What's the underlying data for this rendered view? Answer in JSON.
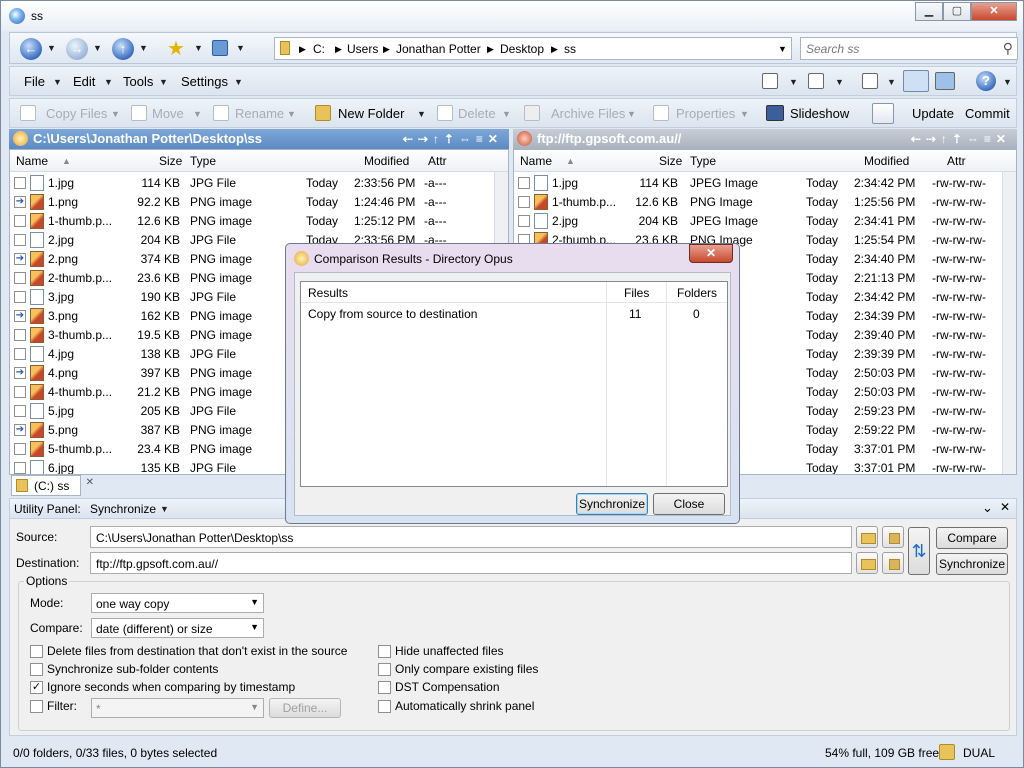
{
  "window": {
    "title": "ss"
  },
  "address": {
    "drive": "C:",
    "parts": [
      "Users",
      "Jonathan Potter",
      "Desktop",
      "ss"
    ]
  },
  "search": {
    "placeholder": "Search ss"
  },
  "menu": {
    "file": "File",
    "edit": "Edit",
    "tools": "Tools",
    "settings": "Settings"
  },
  "toolbar": {
    "copy_files": "Copy Files",
    "move": "Move",
    "rename": "Rename",
    "new_folder": "New Folder",
    "delete": "Delete",
    "archive_files": "Archive Files",
    "properties": "Properties",
    "slideshow": "Slideshow",
    "update": "Update",
    "commit": "Commit"
  },
  "left_pane": {
    "path": "C:\\Users\\Jonathan Potter\\Desktop\\ss",
    "headers": {
      "name": "Name",
      "size": "Size",
      "type": "Type",
      "modified": "Modified",
      "attr": "Attr"
    },
    "rows": [
      {
        "name": "1.jpg",
        "size": "114 KB",
        "type": "JPG File",
        "date": "Today",
        "time": "2:33:56 PM",
        "attr": "-a---",
        "kind": "jpg"
      },
      {
        "name": "1.png",
        "size": "92.2 KB",
        "type": "PNG image",
        "date": "Today",
        "time": "1:24:46 PM",
        "attr": "-a---",
        "kind": "pngarrow"
      },
      {
        "name": "1-thumb.p...",
        "size": "12.6 KB",
        "type": "PNG image",
        "date": "Today",
        "time": "1:25:12 PM",
        "attr": "-a---",
        "kind": "png"
      },
      {
        "name": "2.jpg",
        "size": "204 KB",
        "type": "JPG File",
        "date": "Today",
        "time": "2:33:56 PM",
        "attr": "-a---",
        "kind": "jpg"
      },
      {
        "name": "2.png",
        "size": "374 KB",
        "type": "PNG image",
        "date": "",
        "time": "",
        "attr": "",
        "kind": "pngarrow"
      },
      {
        "name": "2-thumb.p...",
        "size": "23.6 KB",
        "type": "PNG image",
        "date": "",
        "time": "",
        "attr": "",
        "kind": "png"
      },
      {
        "name": "3.jpg",
        "size": "190 KB",
        "type": "JPG File",
        "date": "",
        "time": "",
        "attr": "",
        "kind": "jpg"
      },
      {
        "name": "3.png",
        "size": "162 KB",
        "type": "PNG image",
        "date": "",
        "time": "",
        "attr": "",
        "kind": "pngarrow"
      },
      {
        "name": "3-thumb.p...",
        "size": "19.5 KB",
        "type": "PNG image",
        "date": "",
        "time": "",
        "attr": "",
        "kind": "png"
      },
      {
        "name": "4.jpg",
        "size": "138 KB",
        "type": "JPG File",
        "date": "",
        "time": "",
        "attr": "",
        "kind": "jpg"
      },
      {
        "name": "4.png",
        "size": "397 KB",
        "type": "PNG image",
        "date": "",
        "time": "",
        "attr": "",
        "kind": "pngarrow"
      },
      {
        "name": "4-thumb.p...",
        "size": "21.2 KB",
        "type": "PNG image",
        "date": "",
        "time": "",
        "attr": "",
        "kind": "png"
      },
      {
        "name": "5.jpg",
        "size": "205 KB",
        "type": "JPG File",
        "date": "",
        "time": "",
        "attr": "",
        "kind": "jpg"
      },
      {
        "name": "5.png",
        "size": "387 KB",
        "type": "PNG image",
        "date": "",
        "time": "",
        "attr": "",
        "kind": "pngarrow"
      },
      {
        "name": "5-thumb.p...",
        "size": "23.4 KB",
        "type": "PNG image",
        "date": "",
        "time": "",
        "attr": "",
        "kind": "png"
      },
      {
        "name": "6.jpg",
        "size": "135 KB",
        "type": "JPG File",
        "date": "",
        "time": "",
        "attr": "",
        "kind": "jpg"
      }
    ]
  },
  "right_pane": {
    "path": "ftp://ftp.gpsoft.com.au//",
    "headers": {
      "name": "Name",
      "size": "Size",
      "type": "Type",
      "modified": "Modified",
      "attr": "Attr"
    },
    "rows": [
      {
        "name": "1.jpg",
        "size": "114 KB",
        "type": "JPEG Image",
        "date": "Today",
        "time": "2:34:42 PM",
        "attr": "-rw-rw-rw-",
        "kind": "jpg"
      },
      {
        "name": "1-thumb.p...",
        "size": "12.6 KB",
        "type": "PNG Image",
        "date": "Today",
        "time": "1:25:56 PM",
        "attr": "-rw-rw-rw-",
        "kind": "png"
      },
      {
        "name": "2.jpg",
        "size": "204 KB",
        "type": "JPEG Image",
        "date": "Today",
        "time": "2:34:41 PM",
        "attr": "-rw-rw-rw-",
        "kind": "jpg"
      },
      {
        "name": "2-thumb.p...",
        "size": "23.6 KB",
        "type": "PNG Image",
        "date": "Today",
        "time": "1:25:54 PM",
        "attr": "-rw-rw-rw-",
        "kind": "png"
      },
      {
        "name": "",
        "size": "",
        "type": "ge",
        "date": "Today",
        "time": "2:34:40 PM",
        "attr": "-rw-rw-rw-",
        "kind": ""
      },
      {
        "name": "",
        "size": "",
        "type": "ge",
        "date": "Today",
        "time": "2:21:13 PM",
        "attr": "-rw-rw-rw-",
        "kind": ""
      },
      {
        "name": "",
        "size": "",
        "type": "ge",
        "date": "Today",
        "time": "2:34:42 PM",
        "attr": "-rw-rw-rw-",
        "kind": ""
      },
      {
        "name": "",
        "size": "",
        "type": "ge",
        "date": "Today",
        "time": "2:34:39 PM",
        "attr": "-rw-rw-rw-",
        "kind": ""
      },
      {
        "name": "",
        "size": "",
        "type": "ge",
        "date": "Today",
        "time": "2:39:40 PM",
        "attr": "-rw-rw-rw-",
        "kind": ""
      },
      {
        "name": "",
        "size": "",
        "type": "ge",
        "date": "Today",
        "time": "2:39:39 PM",
        "attr": "-rw-rw-rw-",
        "kind": ""
      },
      {
        "name": "",
        "size": "",
        "type": "ge",
        "date": "Today",
        "time": "2:50:03 PM",
        "attr": "-rw-rw-rw-",
        "kind": ""
      },
      {
        "name": "",
        "size": "",
        "type": "ge",
        "date": "Today",
        "time": "2:50:03 PM",
        "attr": "-rw-rw-rw-",
        "kind": ""
      },
      {
        "name": "",
        "size": "",
        "type": "ge",
        "date": "Today",
        "time": "2:59:23 PM",
        "attr": "-rw-rw-rw-",
        "kind": ""
      },
      {
        "name": "",
        "size": "",
        "type": "ge",
        "date": "Today",
        "time": "2:59:22 PM",
        "attr": "-rw-rw-rw-",
        "kind": ""
      },
      {
        "name": "",
        "size": "",
        "type": "ge",
        "date": "Today",
        "time": "3:37:01 PM",
        "attr": "-rw-rw-rw-",
        "kind": ""
      },
      {
        "name": "",
        "size": "",
        "type": "ge",
        "date": "Today",
        "time": "3:37:01 PM",
        "attr": "-rw-rw-rw-",
        "kind": ""
      }
    ]
  },
  "tab": {
    "label": "(C:) ss"
  },
  "utility": {
    "title": "Utility Panel:",
    "mode_label": "Synchronize",
    "source_label": "Source:",
    "source_value": "C:\\Users\\Jonathan Potter\\Desktop\\ss",
    "dest_label": "Destination:",
    "dest_value": "ftp://ftp.gpsoft.com.au//",
    "compare_btn": "Compare",
    "sync_btn": "Synchronize",
    "options_label": "Options",
    "mode_field_label": "Mode:",
    "mode_value": "one way copy",
    "compare_field_label": "Compare:",
    "compare_value": "date (different) or size",
    "checks_left": [
      {
        "label": "Delete files from destination that don't exist in the source",
        "checked": false
      },
      {
        "label": "Synchronize sub-folder contents",
        "checked": false
      },
      {
        "label": "Ignore seconds when comparing by timestamp",
        "checked": true
      },
      {
        "label": "Filter:",
        "checked": false
      }
    ],
    "filter_value": "*",
    "define_btn": "Define...",
    "checks_right": [
      {
        "label": "Hide unaffected files",
        "checked": false
      },
      {
        "label": "Only compare existing files",
        "checked": false
      },
      {
        "label": "DST Compensation",
        "checked": false
      },
      {
        "label": "Automatically shrink panel",
        "checked": false
      }
    ]
  },
  "status": {
    "selection": "0/0 folders, 0/33 files, 0 bytes selected",
    "disk": "54% full, 109 GB free",
    "mode": "DUAL"
  },
  "dialog": {
    "title": "Comparison Results - Directory Opus",
    "headers": {
      "results": "Results",
      "files": "Files",
      "folders": "Folders"
    },
    "rows": [
      {
        "results": "Copy from source to destination",
        "files": "11",
        "folders": "0"
      }
    ],
    "sync_btn": "Synchronize",
    "close_btn": "Close"
  }
}
